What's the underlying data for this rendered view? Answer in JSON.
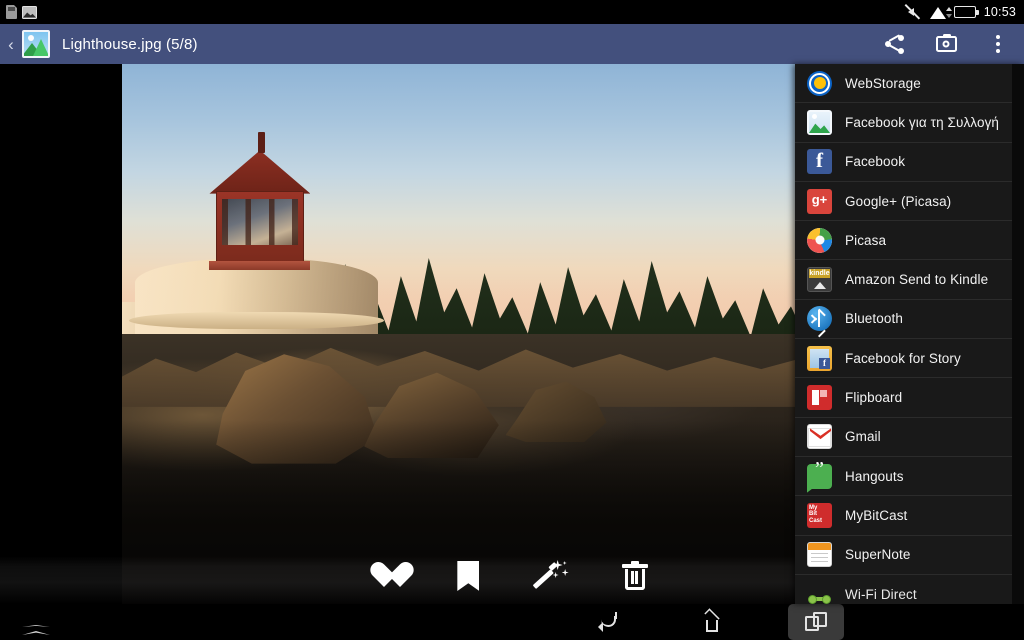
{
  "status_bar": {
    "notifications": [
      {
        "name": "sdcard-icon"
      },
      {
        "name": "screenshot-icon"
      }
    ],
    "silent_icon": "mute-icon",
    "wifi_icon": "wifi-icon",
    "battery_icon": "battery-icon",
    "time": "10:53"
  },
  "toolbar": {
    "back_label": "‹",
    "app_icon": "gallery-icon",
    "title": "Lighthouse.jpg (5/8)",
    "actions": [
      {
        "name": "share-icon",
        "label": "Share"
      },
      {
        "name": "camera-icon",
        "label": "Camera"
      },
      {
        "name": "overflow-menu-icon",
        "label": "More options"
      }
    ],
    "background_color": "#43507d"
  },
  "photo": {
    "file_name": "Lighthouse.jpg",
    "index": "5",
    "total": "8",
    "alt": "Lighthouse on rocky coastline at sunset"
  },
  "photo_actions": [
    {
      "name": "favorite-button",
      "icon": "heart-icon",
      "label": "Favorite"
    },
    {
      "name": "bookmark-button",
      "icon": "bookmark-icon",
      "label": "Bookmark"
    },
    {
      "name": "enhance-button",
      "icon": "magic-wand-icon",
      "label": "Enhance"
    },
    {
      "name": "delete-button",
      "icon": "trash-icon",
      "label": "Delete"
    }
  ],
  "share_panel": {
    "background_color": "#191919",
    "items": [
      {
        "label": "WebStorage",
        "icon": "webstorage-icon"
      },
      {
        "label": "Facebook για τη Συλλογή",
        "icon": "facebook-collection-icon"
      },
      {
        "label": "Facebook",
        "icon": "facebook-icon"
      },
      {
        "label": "Google+ (Picasa)",
        "icon": "google-plus-icon"
      },
      {
        "label": "Picasa",
        "icon": "picasa-icon"
      },
      {
        "label": "Amazon Send to Kindle",
        "icon": "kindle-icon"
      },
      {
        "label": "Bluetooth",
        "icon": "bluetooth-icon"
      },
      {
        "label": "Facebook for Story",
        "icon": "facebook-story-icon"
      },
      {
        "label": "Flipboard",
        "icon": "flipboard-icon"
      },
      {
        "label": "Gmail",
        "icon": "gmail-icon"
      },
      {
        "label": "Hangouts",
        "icon": "hangouts-icon"
      },
      {
        "label": "MyBitCast",
        "icon": "mybitcast-icon"
      },
      {
        "label": "SuperNote",
        "icon": "supernote-icon"
      },
      {
        "label": "Wi-Fi Direct",
        "icon": "wifi-direct-icon"
      }
    ]
  },
  "nav_bar": {
    "expand_label": "expand-icon",
    "buttons": [
      {
        "name": "nav-back-button",
        "icon": "back-icon",
        "label": "Back"
      },
      {
        "name": "nav-home-button",
        "icon": "home-icon",
        "label": "Home"
      },
      {
        "name": "nav-recents-button",
        "icon": "recents-icon",
        "label": "Recent apps"
      }
    ]
  }
}
